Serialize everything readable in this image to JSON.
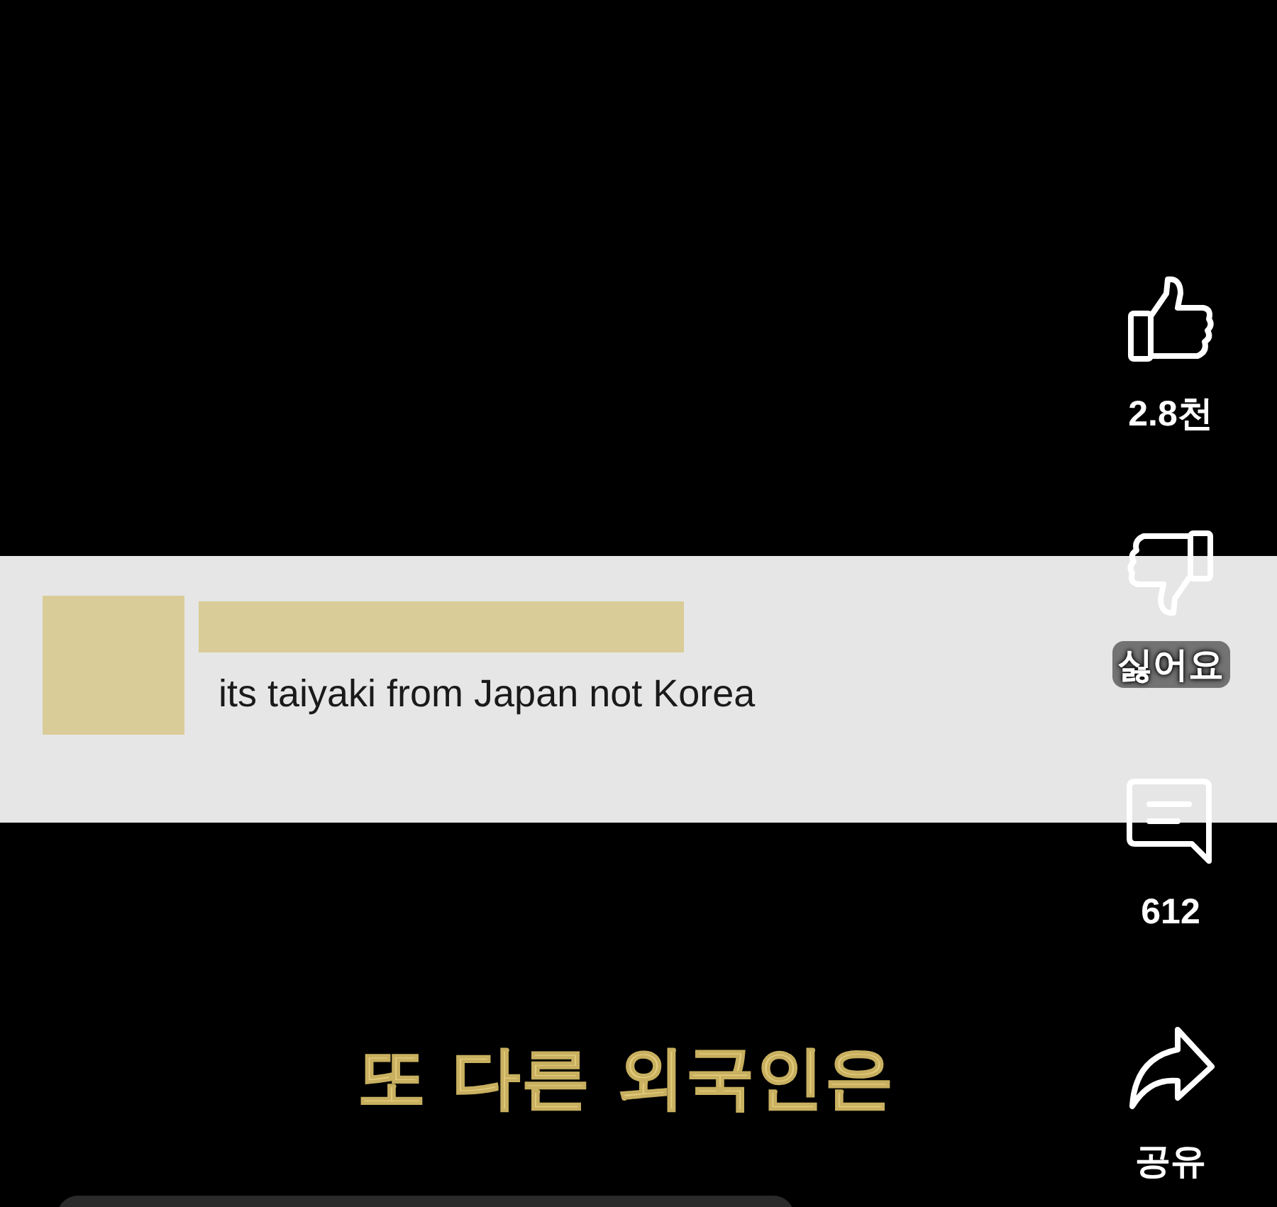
{
  "comment": {
    "text": "its taiyaki from Japan not Korea"
  },
  "caption": "또 다른 외국인은",
  "actions": [
    {
      "kind": "like",
      "label": "2.8천"
    },
    {
      "kind": "dislike",
      "label": "싫어요"
    },
    {
      "kind": "comment",
      "label": "612"
    },
    {
      "kind": "share",
      "label": "공유"
    }
  ]
}
